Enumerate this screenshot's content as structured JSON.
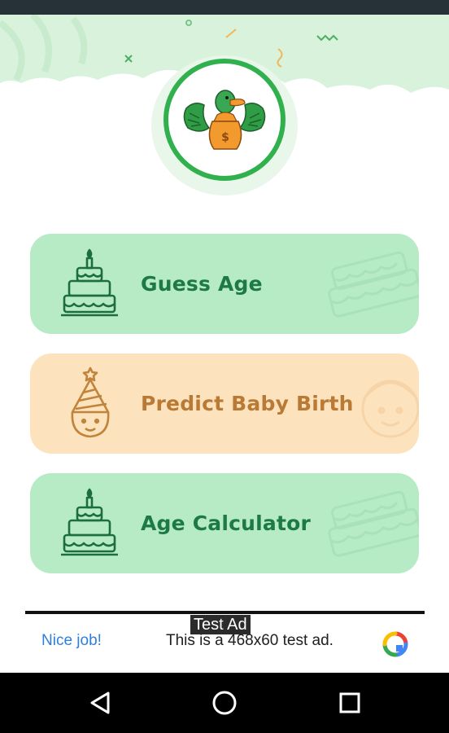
{
  "app": {
    "logo_icon": "duck-money-bag-icon",
    "brand_green": "#31b04e"
  },
  "menu": [
    {
      "label": "Guess Age",
      "icon": "birthday-cake-icon",
      "color": "#b7ebc6"
    },
    {
      "label": "Predict Baby Birth",
      "icon": "party-hat-baby-icon",
      "color": "#fde3bd"
    },
    {
      "label": "Age Calculator",
      "icon": "birthday-cake-icon",
      "color": "#b7ebc6"
    }
  ],
  "ad": {
    "tag": "Test Ad",
    "left_text": "Nice job!",
    "text": "This is a 468x60 test ad.",
    "logo_icon": "ad-choices-logo-icon"
  },
  "navigation": {
    "back_icon": "back-triangle-icon",
    "home_icon": "home-circle-icon",
    "recents_icon": "recents-square-icon"
  }
}
